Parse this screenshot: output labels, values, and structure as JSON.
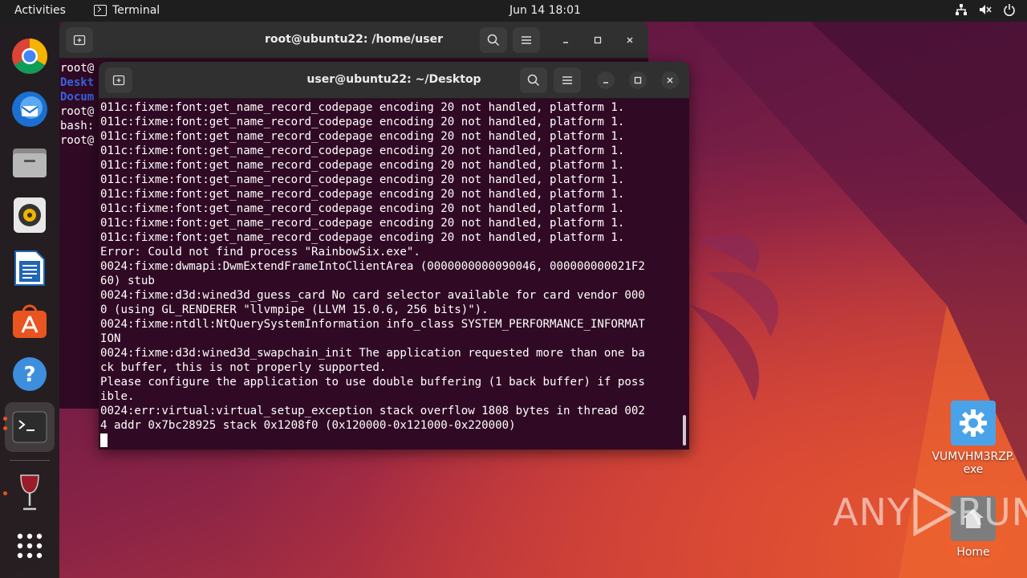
{
  "topbar": {
    "activities": "Activities",
    "app_name": "Terminal",
    "clock": "Jun 14  18:01"
  },
  "dock": {
    "items": [
      "chrome-icon",
      "thunderbird-icon",
      "files-icon",
      "rhythmbox-icon",
      "writer-icon",
      "app-center-icon",
      "help-icon",
      "terminal-icon",
      "wine-icon",
      "show-apps-icon"
    ]
  },
  "back_window": {
    "title": "root@ubuntu22: /home/user",
    "lines": [
      {
        "text": "root@",
        "color": "default"
      },
      {
        "text": "Deskt",
        "color": "blue"
      },
      {
        "text": "Docum",
        "color": "blue"
      },
      {
        "text": "root@",
        "color": "default"
      },
      {
        "text": "bash:",
        "color": "default"
      },
      {
        "text": "root@",
        "color": "default"
      }
    ]
  },
  "front_window": {
    "title": "user@ubuntu22: ~/Desktop",
    "lines": [
      "011c:fixme:font:get_name_record_codepage encoding 20 not handled, platform 1.",
      "011c:fixme:font:get_name_record_codepage encoding 20 not handled, platform 1.",
      "011c:fixme:font:get_name_record_codepage encoding 20 not handled, platform 1.",
      "011c:fixme:font:get_name_record_codepage encoding 20 not handled, platform 1.",
      "011c:fixme:font:get_name_record_codepage encoding 20 not handled, platform 1.",
      "011c:fixme:font:get_name_record_codepage encoding 20 not handled, platform 1.",
      "011c:fixme:font:get_name_record_codepage encoding 20 not handled, platform 1.",
      "011c:fixme:font:get_name_record_codepage encoding 20 not handled, platform 1.",
      "011c:fixme:font:get_name_record_codepage encoding 20 not handled, platform 1.",
      "011c:fixme:font:get_name_record_codepage encoding 20 not handled, platform 1.",
      "Error: Could not find process \"RainbowSix.exe\".",
      "0024:fixme:dwmapi:DwmExtendFrameIntoClientArea (0000000000090046, 000000000021F2",
      "60) stub",
      "0024:fixme:d3d:wined3d_guess_card No card selector available for card vendor 000",
      "0 (using GL_RENDERER \"llvmpipe (LLVM 15.0.6, 256 bits)\").",
      "0024:fixme:ntdll:NtQuerySystemInformation info_class SYSTEM_PERFORMANCE_INFORMAT",
      "ION",
      "0024:fixme:d3d:wined3d_swapchain_init The application requested more than one ba",
      "ck buffer, this is not properly supported.",
      "Please configure the application to use double buffering (1 back buffer) if poss",
      "ible.",
      "0024:err:virtual:virtual_setup_exception stack overflow 1808 bytes in thread 002",
      "4 addr 0x7bc28925 stack 0x1208f0 (0x120000-0x121000-0x220000)"
    ]
  },
  "desktop": {
    "exe_icon_label_line1": "VUMVHM3RZP.",
    "exe_icon_label_line2": "exe",
    "home_label": "Home"
  },
  "watermark": {
    "text_left": "ANY",
    "text_right": "RUN"
  },
  "colors": {
    "terminal_bg": "#300a24",
    "accent": "#e95420",
    "header": "#303030"
  }
}
